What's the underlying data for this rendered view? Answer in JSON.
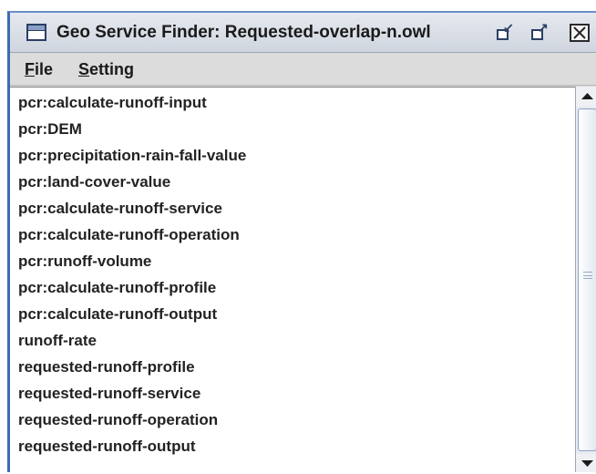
{
  "window": {
    "title": "Geo Service Finder: Requested-overlap-n.owl",
    "controls": {
      "minimize_icon": "minimize-icon",
      "maximize_icon": "maximize-icon",
      "close_icon": "close-icon"
    }
  },
  "menu": {
    "file": {
      "mnemonic": "F",
      "rest": "ile"
    },
    "setting": {
      "mnemonic": "S",
      "rest": "etting"
    }
  },
  "list": {
    "items": [
      "pcr:calculate-runoff-input",
      "pcr:DEM",
      "pcr:precipitation-rain-fall-value",
      "pcr:land-cover-value",
      "pcr:calculate-runoff-service",
      "pcr:calculate-runoff-operation",
      "pcr:runoff-volume",
      "pcr:calculate-runoff-profile",
      "pcr:calculate-runoff-output",
      "runoff-rate",
      "requested-runoff-profile",
      "requested-runoff-service",
      "requested-runoff-operation",
      "requested-runoff-output"
    ]
  },
  "colors": {
    "window_border": "#3e6bb0",
    "text": "#222222",
    "scroll_arrow": "#1a1a1a"
  }
}
